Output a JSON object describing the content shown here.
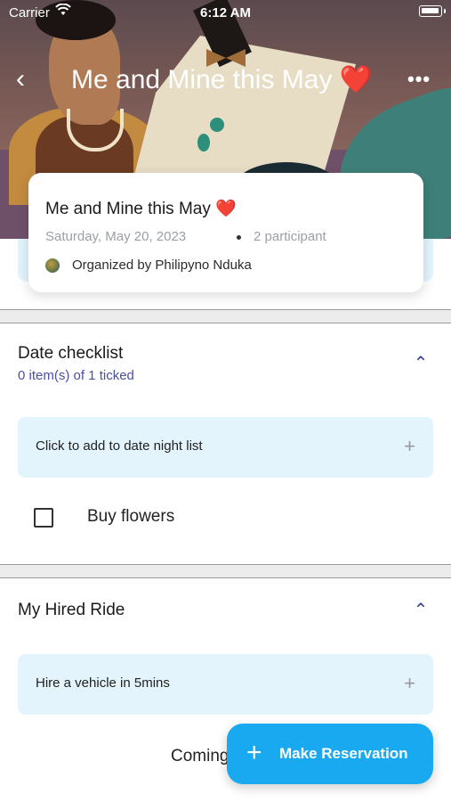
{
  "status_bar": {
    "carrier": "Carrier",
    "time": "6:12 AM"
  },
  "nav": {
    "back_icon": "‹",
    "title": "Me and Mine this May ❤️",
    "more_icon": "•••"
  },
  "event": {
    "title": "Me and Mine this May ❤️",
    "date": "Saturday, May 20, 2023",
    "participants": "2 participant",
    "organizer": "Organized by Philipyno Nduka"
  },
  "checklist": {
    "title": "Date checklist",
    "subtitle": "0 item(s) of 1 ticked",
    "add_label": "Click to add to date night list",
    "items": [
      {
        "label": "Buy flowers",
        "checked": false
      }
    ]
  },
  "ride": {
    "title": "My Hired Ride",
    "add_label": "Hire a vehicle in 5mins",
    "coming": "Coming"
  },
  "fab": {
    "label": "Make Reservation"
  },
  "colors": {
    "accent": "#19a9f0",
    "soft_blue": "#e3f4fc",
    "subtitle": "#4b4fa0"
  }
}
